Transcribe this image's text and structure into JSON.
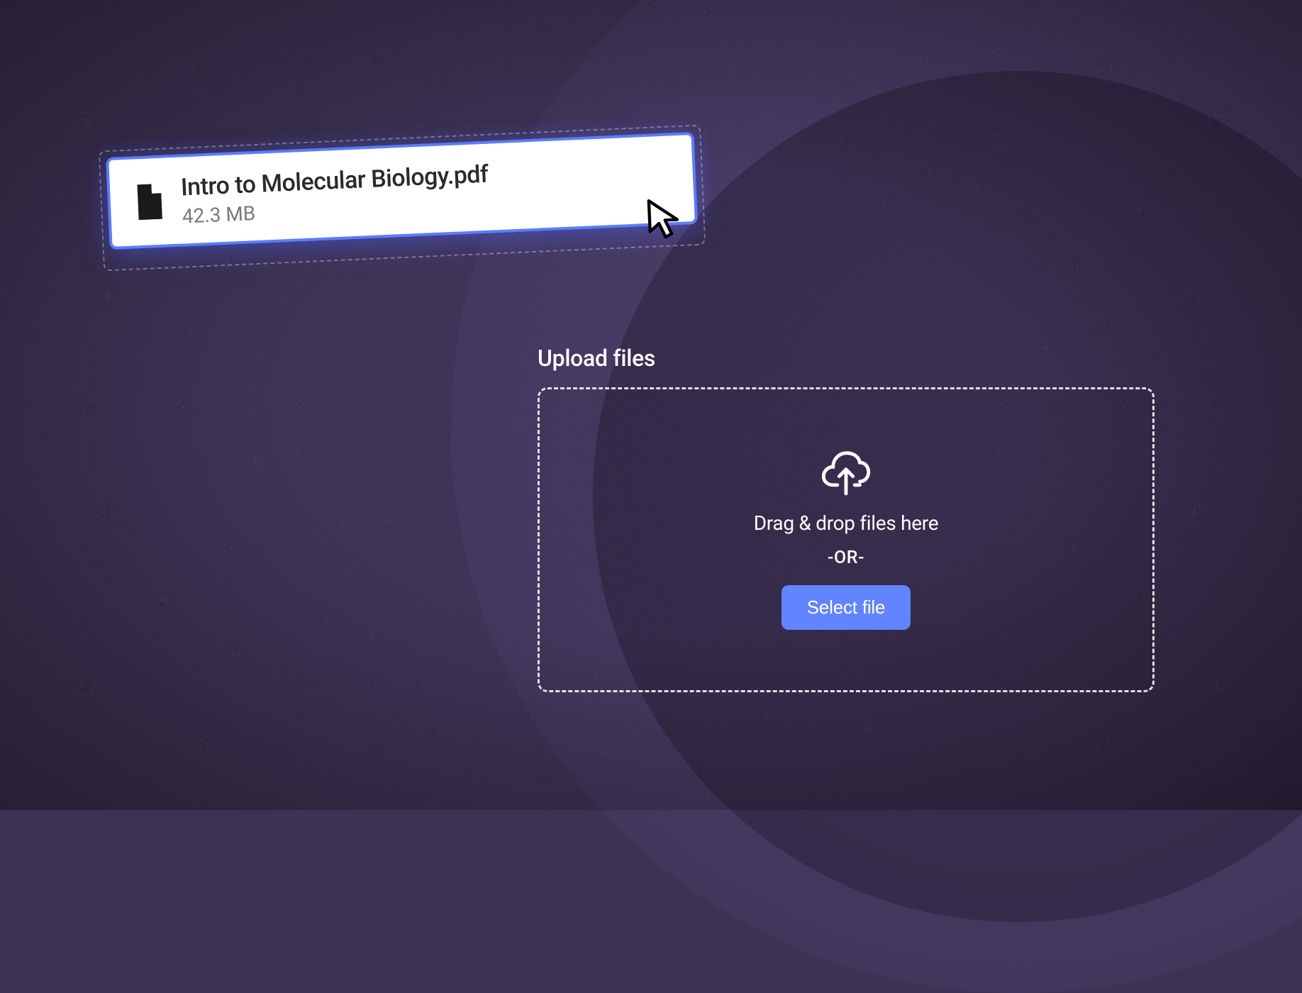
{
  "file_card": {
    "name": "Intro to Molecular Biology.pdf",
    "size": "42.3 MB"
  },
  "upload": {
    "title": "Upload files",
    "dropzone_text": "Drag & drop files here",
    "or_text": "-OR-",
    "button_label": "Select file"
  },
  "colors": {
    "accent_blue": "#5b7cff",
    "button_blue": "#6384ff",
    "bg_purple": "#3d3254"
  }
}
